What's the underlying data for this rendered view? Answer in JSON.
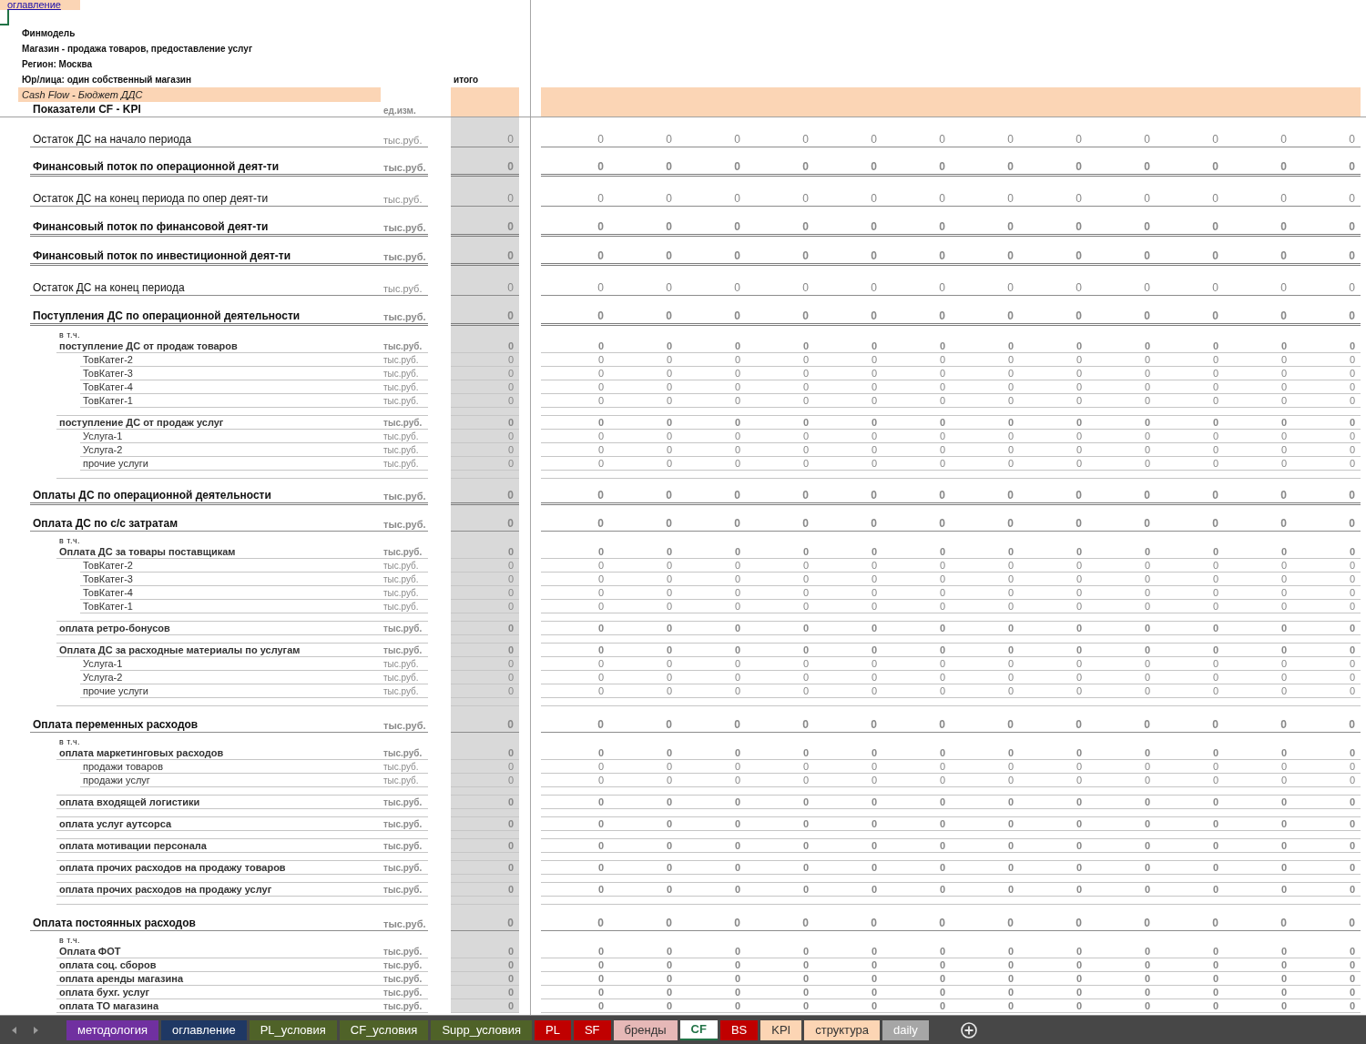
{
  "toc_link": "оглавление",
  "header": {
    "lines": [
      "Финмодель",
      "Магазин - продажа товаров, предоставление услуг",
      "Регион: Москва",
      "Юр/лица: один собственный магазин"
    ],
    "total_heading": "итого",
    "section_title": "Cash Flow - Бюджет ДДС",
    "table_title": "Показатели CF - KPI",
    "unit_heading": "ед.изм."
  },
  "summary_rows": [
    {
      "label": "Остаток ДС на начало периода",
      "bold": false,
      "double_rule": false,
      "unit": "тыс.руб.",
      "total": "0",
      "values": [
        "0",
        "0",
        "0",
        "0",
        "0",
        "0",
        "0",
        "0",
        "0",
        "0",
        "0",
        "0"
      ]
    },
    {
      "label": "Финансовый поток по операционной деят-ти",
      "bold": true,
      "double_rule": true,
      "unit": "тыс.руб.",
      "total": "0",
      "values": [
        "0",
        "0",
        "0",
        "0",
        "0",
        "0",
        "0",
        "0",
        "0",
        "0",
        "0",
        "0"
      ]
    },
    {
      "label": "Остаток ДС на конец периода по опер деят-ти",
      "bold": false,
      "double_rule": false,
      "unit": "тыс.руб.",
      "total": "0",
      "values": [
        "0",
        "0",
        "0",
        "0",
        "0",
        "0",
        "0",
        "0",
        "0",
        "0",
        "0",
        "0"
      ]
    },
    {
      "label": "Финансовый поток по финансовой деят-ти",
      "bold": true,
      "double_rule": true,
      "unit": "тыс.руб.",
      "total": "0",
      "values": [
        "0",
        "0",
        "0",
        "0",
        "0",
        "0",
        "0",
        "0",
        "0",
        "0",
        "0",
        "0"
      ]
    },
    {
      "label": "Финансовый поток по инвестиционной деят-ти",
      "bold": true,
      "double_rule": true,
      "unit": "тыс.руб.",
      "total": "0",
      "values": [
        "0",
        "0",
        "0",
        "0",
        "0",
        "0",
        "0",
        "0",
        "0",
        "0",
        "0",
        "0"
      ]
    },
    {
      "label": "Остаток ДС на конец периода",
      "bold": false,
      "double_rule": false,
      "unit": "тыс.руб.",
      "total": "0",
      "values": [
        "0",
        "0",
        "0",
        "0",
        "0",
        "0",
        "0",
        "0",
        "0",
        "0",
        "0",
        "0"
      ]
    },
    {
      "label": "Поступления ДС по операционной деятельности",
      "bold": true,
      "double_rule": true,
      "unit": "тыс.руб.",
      "total": "0",
      "values": [
        "0",
        "0",
        "0",
        "0",
        "0",
        "0",
        "0",
        "0",
        "0",
        "0",
        "0",
        "0"
      ]
    }
  ],
  "detail_rows": [
    {
      "kind": "note",
      "label": "в т.ч."
    },
    {
      "kind": "group",
      "label": "поступление ДС от продаж товаров",
      "unit": "тыс.руб.",
      "total": "0",
      "values": [
        "0",
        "0",
        "0",
        "0",
        "0",
        "0",
        "0",
        "0",
        "0",
        "0",
        "0",
        "0"
      ]
    },
    {
      "kind": "item",
      "label": "ТовКатег-2",
      "unit": "тыс.руб.",
      "total": "0",
      "values": [
        "0",
        "0",
        "0",
        "0",
        "0",
        "0",
        "0",
        "0",
        "0",
        "0",
        "0",
        "0"
      ]
    },
    {
      "kind": "item",
      "label": "ТовКатег-3",
      "unit": "тыс.руб.",
      "total": "0",
      "values": [
        "0",
        "0",
        "0",
        "0",
        "0",
        "0",
        "0",
        "0",
        "0",
        "0",
        "0",
        "0"
      ]
    },
    {
      "kind": "item",
      "label": "ТовКатег-4",
      "unit": "тыс.руб.",
      "total": "0",
      "values": [
        "0",
        "0",
        "0",
        "0",
        "0",
        "0",
        "0",
        "0",
        "0",
        "0",
        "0",
        "0"
      ]
    },
    {
      "kind": "item",
      "label": "ТовКатег-1",
      "unit": "тыс.руб.",
      "total": "0",
      "values": [
        "0",
        "0",
        "0",
        "0",
        "0",
        "0",
        "0",
        "0",
        "0",
        "0",
        "0",
        "0"
      ]
    },
    {
      "kind": "spacer"
    },
    {
      "kind": "group",
      "label": "поступление ДС от продаж услуг",
      "unit": "тыс.руб.",
      "total": "0",
      "values": [
        "0",
        "0",
        "0",
        "0",
        "0",
        "0",
        "0",
        "0",
        "0",
        "0",
        "0",
        "0"
      ]
    },
    {
      "kind": "item",
      "label": "Услуга-1",
      "unit": "тыс.руб.",
      "total": "0",
      "values": [
        "0",
        "0",
        "0",
        "0",
        "0",
        "0",
        "0",
        "0",
        "0",
        "0",
        "0",
        "0"
      ]
    },
    {
      "kind": "item",
      "label": "Услуга-2",
      "unit": "тыс.руб.",
      "total": "0",
      "values": [
        "0",
        "0",
        "0",
        "0",
        "0",
        "0",
        "0",
        "0",
        "0",
        "0",
        "0",
        "0"
      ]
    },
    {
      "kind": "item",
      "label": "прочие услуги",
      "unit": "тыс.руб.",
      "total": "0",
      "values": [
        "0",
        "0",
        "0",
        "0",
        "0",
        "0",
        "0",
        "0",
        "0",
        "0",
        "0",
        "0"
      ]
    },
    {
      "kind": "spacer"
    },
    {
      "kind": "total",
      "label": "Оплаты ДС по операционной деятельности",
      "bold": true,
      "double_rule": true,
      "unit": "тыс.руб.",
      "total": "0",
      "values": [
        "0",
        "0",
        "0",
        "0",
        "0",
        "0",
        "0",
        "0",
        "0",
        "0",
        "0",
        "0"
      ]
    },
    {
      "kind": "total",
      "label": "Оплата ДС по с/с затратам",
      "bold": true,
      "double_rule": false,
      "unit": "тыс.руб.",
      "total": "0",
      "values": [
        "0",
        "0",
        "0",
        "0",
        "0",
        "0",
        "0",
        "0",
        "0",
        "0",
        "0",
        "0"
      ]
    },
    {
      "kind": "note",
      "label": "в т.ч."
    },
    {
      "kind": "group",
      "label": "Оплата ДС за товары поставщикам",
      "unit": "тыс.руб.",
      "total": "0",
      "values": [
        "0",
        "0",
        "0",
        "0",
        "0",
        "0",
        "0",
        "0",
        "0",
        "0",
        "0",
        "0"
      ]
    },
    {
      "kind": "item",
      "label": "ТовКатег-2",
      "unit": "тыс.руб.",
      "total": "0",
      "values": [
        "0",
        "0",
        "0",
        "0",
        "0",
        "0",
        "0",
        "0",
        "0",
        "0",
        "0",
        "0"
      ]
    },
    {
      "kind": "item",
      "label": "ТовКатег-3",
      "unit": "тыс.руб.",
      "total": "0",
      "values": [
        "0",
        "0",
        "0",
        "0",
        "0",
        "0",
        "0",
        "0",
        "0",
        "0",
        "0",
        "0"
      ]
    },
    {
      "kind": "item",
      "label": "ТовКатег-4",
      "unit": "тыс.руб.",
      "total": "0",
      "values": [
        "0",
        "0",
        "0",
        "0",
        "0",
        "0",
        "0",
        "0",
        "0",
        "0",
        "0",
        "0"
      ]
    },
    {
      "kind": "item",
      "label": "ТовКатег-1",
      "unit": "тыс.руб.",
      "total": "0",
      "values": [
        "0",
        "0",
        "0",
        "0",
        "0",
        "0",
        "0",
        "0",
        "0",
        "0",
        "0",
        "0"
      ]
    },
    {
      "kind": "spacer"
    },
    {
      "kind": "group",
      "label": "оплата ретро-бонусов",
      "unit": "тыс.руб.",
      "total": "0",
      "values": [
        "0",
        "0",
        "0",
        "0",
        "0",
        "0",
        "0",
        "0",
        "0",
        "0",
        "0",
        "0"
      ]
    },
    {
      "kind": "spacer"
    },
    {
      "kind": "group",
      "label": "Оплата ДС за расходные материалы по услугам",
      "unit": "тыс.руб.",
      "total": "0",
      "values": [
        "0",
        "0",
        "0",
        "0",
        "0",
        "0",
        "0",
        "0",
        "0",
        "0",
        "0",
        "0"
      ]
    },
    {
      "kind": "item",
      "label": "Услуга-1",
      "unit": "тыс.руб.",
      "total": "0",
      "values": [
        "0",
        "0",
        "0",
        "0",
        "0",
        "0",
        "0",
        "0",
        "0",
        "0",
        "0",
        "0"
      ]
    },
    {
      "kind": "item",
      "label": "Услуга-2",
      "unit": "тыс.руб.",
      "total": "0",
      "values": [
        "0",
        "0",
        "0",
        "0",
        "0",
        "0",
        "0",
        "0",
        "0",
        "0",
        "0",
        "0"
      ]
    },
    {
      "kind": "item",
      "label": "прочие услуги",
      "unit": "тыс.руб.",
      "total": "0",
      "values": [
        "0",
        "0",
        "0",
        "0",
        "0",
        "0",
        "0",
        "0",
        "0",
        "0",
        "0",
        "0"
      ]
    },
    {
      "kind": "spacer"
    },
    {
      "kind": "total",
      "label": "Оплата переменных расходов",
      "bold": true,
      "double_rule": false,
      "unit": "тыс.руб.",
      "total": "0",
      "values": [
        "0",
        "0",
        "0",
        "0",
        "0",
        "0",
        "0",
        "0",
        "0",
        "0",
        "0",
        "0"
      ]
    },
    {
      "kind": "note",
      "label": "в т.ч."
    },
    {
      "kind": "group",
      "label": "оплата маркетинговых расходов",
      "unit": "тыс.руб.",
      "total": "0",
      "values": [
        "0",
        "0",
        "0",
        "0",
        "0",
        "0",
        "0",
        "0",
        "0",
        "0",
        "0",
        "0"
      ]
    },
    {
      "kind": "item",
      "label": "продажи товаров",
      "unit": "тыс.руб.",
      "total": "0",
      "values": [
        "0",
        "0",
        "0",
        "0",
        "0",
        "0",
        "0",
        "0",
        "0",
        "0",
        "0",
        "0"
      ]
    },
    {
      "kind": "item",
      "label": "продажи услуг",
      "unit": "тыс.руб.",
      "total": "0",
      "values": [
        "0",
        "0",
        "0",
        "0",
        "0",
        "0",
        "0",
        "0",
        "0",
        "0",
        "0",
        "0"
      ]
    },
    {
      "kind": "spacer"
    },
    {
      "kind": "group",
      "label": "оплата входящей логистики",
      "unit": "тыс.руб.",
      "total": "0",
      "values": [
        "0",
        "0",
        "0",
        "0",
        "0",
        "0",
        "0",
        "0",
        "0",
        "0",
        "0",
        "0"
      ]
    },
    {
      "kind": "spacer"
    },
    {
      "kind": "group",
      "label": "оплата услуг аутсорса",
      "unit": "тыс.руб.",
      "total": "0",
      "values": [
        "0",
        "0",
        "0",
        "0",
        "0",
        "0",
        "0",
        "0",
        "0",
        "0",
        "0",
        "0"
      ]
    },
    {
      "kind": "spacer"
    },
    {
      "kind": "group",
      "label": "оплата мотивации персонала",
      "unit": "тыс.руб.",
      "total": "0",
      "values": [
        "0",
        "0",
        "0",
        "0",
        "0",
        "0",
        "0",
        "0",
        "0",
        "0",
        "0",
        "0"
      ]
    },
    {
      "kind": "spacer"
    },
    {
      "kind": "group",
      "label": "оплата прочих расходов на продажу товаров",
      "unit": "тыс.руб.",
      "total": "0",
      "values": [
        "0",
        "0",
        "0",
        "0",
        "0",
        "0",
        "0",
        "0",
        "0",
        "0",
        "0",
        "0"
      ]
    },
    {
      "kind": "spacer"
    },
    {
      "kind": "group",
      "label": "оплата прочих расходов на продажу услуг",
      "unit": "тыс.руб.",
      "total": "0",
      "values": [
        "0",
        "0",
        "0",
        "0",
        "0",
        "0",
        "0",
        "0",
        "0",
        "0",
        "0",
        "0"
      ]
    },
    {
      "kind": "spacer"
    },
    {
      "kind": "total",
      "label": "Оплата постоянных расходов",
      "bold": true,
      "double_rule": false,
      "unit": "тыс.руб.",
      "total": "0",
      "values": [
        "0",
        "0",
        "0",
        "0",
        "0",
        "0",
        "0",
        "0",
        "0",
        "0",
        "0",
        "0"
      ]
    },
    {
      "kind": "note",
      "label": "в т.ч."
    },
    {
      "kind": "group",
      "label": "Оплата ФОТ",
      "unit": "тыс.руб.",
      "total": "0",
      "values": [
        "0",
        "0",
        "0",
        "0",
        "0",
        "0",
        "0",
        "0",
        "0",
        "0",
        "0",
        "0"
      ]
    },
    {
      "kind": "group",
      "label": "оплата соц. сборов",
      "unit": "тыс.руб.",
      "total": "0",
      "values": [
        "0",
        "0",
        "0",
        "0",
        "0",
        "0",
        "0",
        "0",
        "0",
        "0",
        "0",
        "0"
      ]
    },
    {
      "kind": "group",
      "label": "оплата аренды магазина",
      "unit": "тыс.руб.",
      "total": "0",
      "values": [
        "0",
        "0",
        "0",
        "0",
        "0",
        "0",
        "0",
        "0",
        "0",
        "0",
        "0",
        "0"
      ]
    },
    {
      "kind": "group",
      "label": "оплата бухг. услуг",
      "unit": "тыс.руб.",
      "total": "0",
      "values": [
        "0",
        "0",
        "0",
        "0",
        "0",
        "0",
        "0",
        "0",
        "0",
        "0",
        "0",
        "0"
      ]
    },
    {
      "kind": "group",
      "label": "оплата ТО магазина",
      "unit": "тыс.руб.",
      "total": "0",
      "values": [
        "0",
        "0",
        "0",
        "0",
        "0",
        "0",
        "0",
        "0",
        "0",
        "0",
        "0",
        "0"
      ]
    }
  ],
  "sheet_tabs": [
    {
      "label": "методология",
      "color": "#7030a0",
      "selected": false
    },
    {
      "label": "оглавление",
      "color": "#1f3864",
      "selected": false
    },
    {
      "label": "PL_условия",
      "color": "#4f6228",
      "selected": false
    },
    {
      "label": "CF_условия",
      "color": "#4f6228",
      "selected": false
    },
    {
      "label": "Supp_условия",
      "color": "#4f6228",
      "selected": false
    },
    {
      "label": "PL",
      "color": "#c00000",
      "selected": false
    },
    {
      "label": "SF",
      "color": "#c00000",
      "selected": false
    },
    {
      "label": "бренды",
      "color": "#e6b8b7",
      "selected": false
    },
    {
      "label": "CF",
      "color": "#ffffff",
      "selected": true
    },
    {
      "label": "BS",
      "color": "#c00000",
      "selected": false
    },
    {
      "label": "KPI",
      "color": "#fcd5b4",
      "selected": false
    },
    {
      "label": "структура",
      "color": "#fcd5b4",
      "selected": false
    },
    {
      "label": "daily",
      "color": "#a6a6a6",
      "selected": false
    }
  ]
}
